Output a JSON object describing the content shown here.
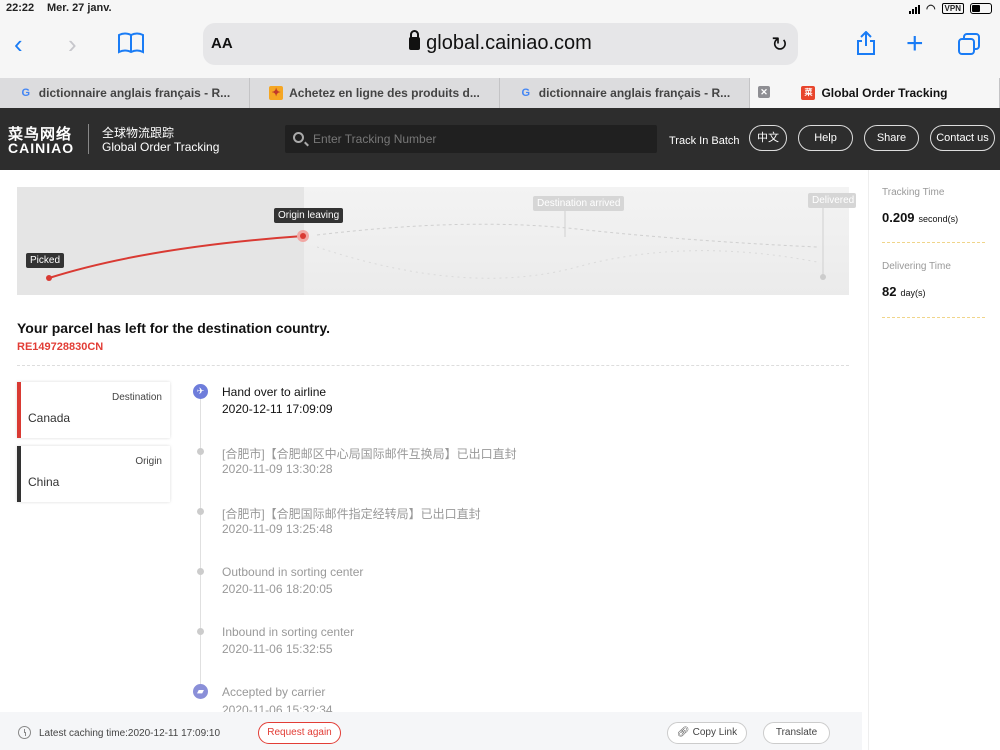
{
  "status": {
    "time": "22:22",
    "date": "Mer. 27 janv.",
    "vpn": "VPN"
  },
  "browser": {
    "text_size_label": "AA",
    "url": "global.cainiao.com",
    "tabs": [
      {
        "label": "dictionnaire anglais français - R..."
      },
      {
        "label": "Achetez en ligne des produits d..."
      },
      {
        "label": "dictionnaire anglais français - R..."
      },
      {
        "label": "Global Order Tracking"
      }
    ]
  },
  "header": {
    "logo_cn": "菜鸟网络",
    "logo_en": "CAINIAO",
    "subtitle_cn": "全球物流跟踪",
    "subtitle_en": "Global Order Tracking",
    "search_placeholder": "Enter Tracking Number",
    "track_batch": "Track In Batch",
    "buttons": {
      "chinese": "中文",
      "help": "Help",
      "share": "Share",
      "contact": "Contact us"
    }
  },
  "progress": {
    "stages": [
      "Picked",
      "Origin leaving",
      "Destination arrived",
      "Delivered"
    ],
    "completed_stage": 2
  },
  "parcel": {
    "headline": "Your parcel has left for the destination country.",
    "tracking_number": "RE149728830CN"
  },
  "route": {
    "destination_label": "Destination",
    "destination": "Canada",
    "origin_label": "Origin",
    "origin": "China"
  },
  "events": [
    {
      "title": "Hand over to airline",
      "time": "2020-12-11 17:09:09",
      "icon": "airplane-icon"
    },
    {
      "title": "[合肥市]【合肥邮区中心局国际邮件互换局】已出口直封",
      "time": "2020-11-09 13:30:28"
    },
    {
      "title": "[合肥市]【合肥国际邮件指定经转局】已出口直封",
      "time": "2020-11-09 13:25:48"
    },
    {
      "title": "Outbound in sorting center",
      "time": "2020-11-06 18:20:05"
    },
    {
      "title": "Inbound in sorting center",
      "time": "2020-11-06 15:32:55"
    },
    {
      "title": "Accepted by carrier",
      "time": "2020-11-06 15:32:34",
      "icon": "truck-icon"
    }
  ],
  "stats": {
    "tracking_time_label": "Tracking Time",
    "tracking_time": "0.209",
    "tracking_time_unit": "second(s)",
    "delivering_time_label": "Delivering Time",
    "delivering_time": "82",
    "delivering_time_unit": "day(s)"
  },
  "footer": {
    "cache_time": "Latest caching time:2020-12-11 17:09:10",
    "request_again": "Request again",
    "copy_link": "Copy Link",
    "translate": "Translate"
  },
  "colors": {
    "brand_red": "#e23d36",
    "header_bg": "#2d2d2d",
    "ios_blue": "#1a7cf5",
    "event_icon": "#6e7ddb"
  }
}
